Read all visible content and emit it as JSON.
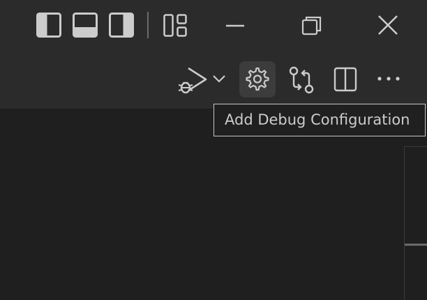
{
  "titlebar": {
    "icons": [
      "toggle-primary-sidebar-icon",
      "toggle-panel-icon",
      "toggle-secondary-sidebar-icon",
      "customize-layout-icon"
    ],
    "window_controls": [
      "minimize-icon",
      "restore-icon",
      "close-icon"
    ]
  },
  "editor_actions": {
    "icons": [
      "run-and-debug-icon",
      "chevron-down-icon",
      "gear-icon",
      "git-compare-icon",
      "split-editor-icon",
      "more-actions-icon"
    ]
  },
  "tooltip": {
    "text": "Add Debug Configuration"
  },
  "colors": {
    "titlebar_bg": "#2b2b2b",
    "editor_bg": "#1f1f1f",
    "icon": "#cccccc",
    "hover_bg": "#3c3c3c",
    "tooltip_border": "#c8c8c8"
  }
}
